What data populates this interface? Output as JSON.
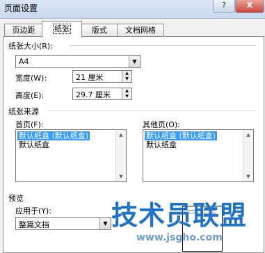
{
  "window": {
    "title": "页面设置"
  },
  "titlebar_buttons": {
    "help": "?",
    "close": "X"
  },
  "tabs": [
    {
      "label": "页边距"
    },
    {
      "label": "纸张"
    },
    {
      "label": "版式"
    },
    {
      "label": "文档网格"
    }
  ],
  "paper_size": {
    "label": "纸张大小(R):",
    "selected": "A4",
    "width_label": "宽度(W):",
    "width_value": "21 厘米",
    "height_label": "高度(E):",
    "height_value": "29.7 厘米"
  },
  "paper_source": {
    "label": "纸张来源",
    "first_page_label": "首页(F):",
    "first_page_items": [
      "默认纸盒 (默认纸盒)",
      "默认纸盒"
    ],
    "other_pages_label": "其他页(O):",
    "other_pages_items": [
      "默认纸盒 (默认纸盒)",
      "默认纸盒"
    ]
  },
  "preview": {
    "label": "预览",
    "apply_to_label": "应用于(Y):",
    "apply_to_value": "整篇文档"
  },
  "watermark": {
    "text": "技术员联盟",
    "url": "www.jsgho.com"
  },
  "colors": {
    "selection": "#3399ff",
    "watermark": "#1e73c7"
  }
}
